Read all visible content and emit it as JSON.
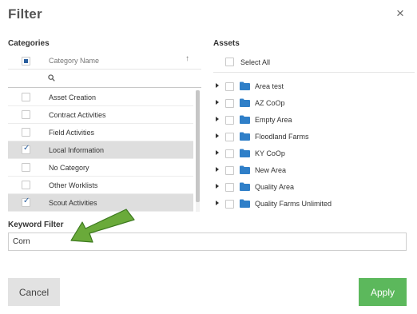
{
  "dialog": {
    "title": "Filter",
    "close_symbol": "×"
  },
  "categories": {
    "heading": "Categories",
    "column_name": "Category Name",
    "sort_icon": "sort-icon",
    "search_icon": "search-icon",
    "items": [
      {
        "label": "Asset Creation",
        "checked": false
      },
      {
        "label": "Contract Activities",
        "checked": false
      },
      {
        "label": "Field Activities",
        "checked": false
      },
      {
        "label": "Local Information",
        "checked": true
      },
      {
        "label": "No Category",
        "checked": false
      },
      {
        "label": "Other Worklists",
        "checked": false
      },
      {
        "label": "Scout Activities",
        "checked": true
      }
    ]
  },
  "assets": {
    "heading": "Assets",
    "select_all": "Select All",
    "folder_icon": "folder-icon",
    "expand_icon": "caret-right-icon",
    "folder_color": "#2f7fc8",
    "items": [
      {
        "label": "Area test"
      },
      {
        "label": "AZ CoOp"
      },
      {
        "label": "Empty Area"
      },
      {
        "label": "Floodland Farms"
      },
      {
        "label": "KY CoOp"
      },
      {
        "label": "New Area"
      },
      {
        "label": "Quality Area"
      },
      {
        "label": "Quality Farms Unlimited"
      }
    ]
  },
  "keyword": {
    "label": "Keyword Filter",
    "value": "Corn"
  },
  "annotation": {
    "icon": "arrow-icon",
    "color": "#6aaa3a"
  },
  "buttons": {
    "cancel": "Cancel",
    "apply": "Apply",
    "apply_color": "#5cb85c"
  }
}
